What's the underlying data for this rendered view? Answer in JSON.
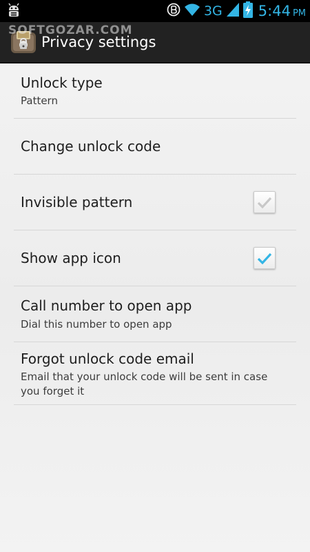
{
  "status_bar": {
    "network_type": "3G",
    "time": "5:44",
    "ampm": "PM",
    "icons": [
      "android-debug-icon",
      "data-sync-icon",
      "wifi-icon",
      "cell-signal-icon",
      "battery-charging-icon"
    ]
  },
  "action_bar": {
    "title": "Privacy settings",
    "watermark": "SOFTGOZAR.COM",
    "icon": "app-lock-icon"
  },
  "settings": {
    "unlock_type": {
      "title": "Unlock type",
      "summary": "Pattern"
    },
    "change_code": {
      "title": "Change unlock code"
    },
    "invisible_pattern": {
      "title": "Invisible pattern",
      "checked": false
    },
    "show_app_icon": {
      "title": "Show app icon",
      "checked": true
    },
    "call_number": {
      "title": "Call number to open app",
      "summary": "Dial this number to open app"
    },
    "forgot_email": {
      "title": "Forgot unlock code email",
      "summary": "Email that your unlock code will be sent in case you forget it"
    }
  },
  "colors": {
    "accent": "#33b5e5",
    "check_on": "#33b5e5",
    "check_off": "#c8c8c8",
    "action_bar_bg": "#222222",
    "status_bar_bg": "#000000"
  }
}
